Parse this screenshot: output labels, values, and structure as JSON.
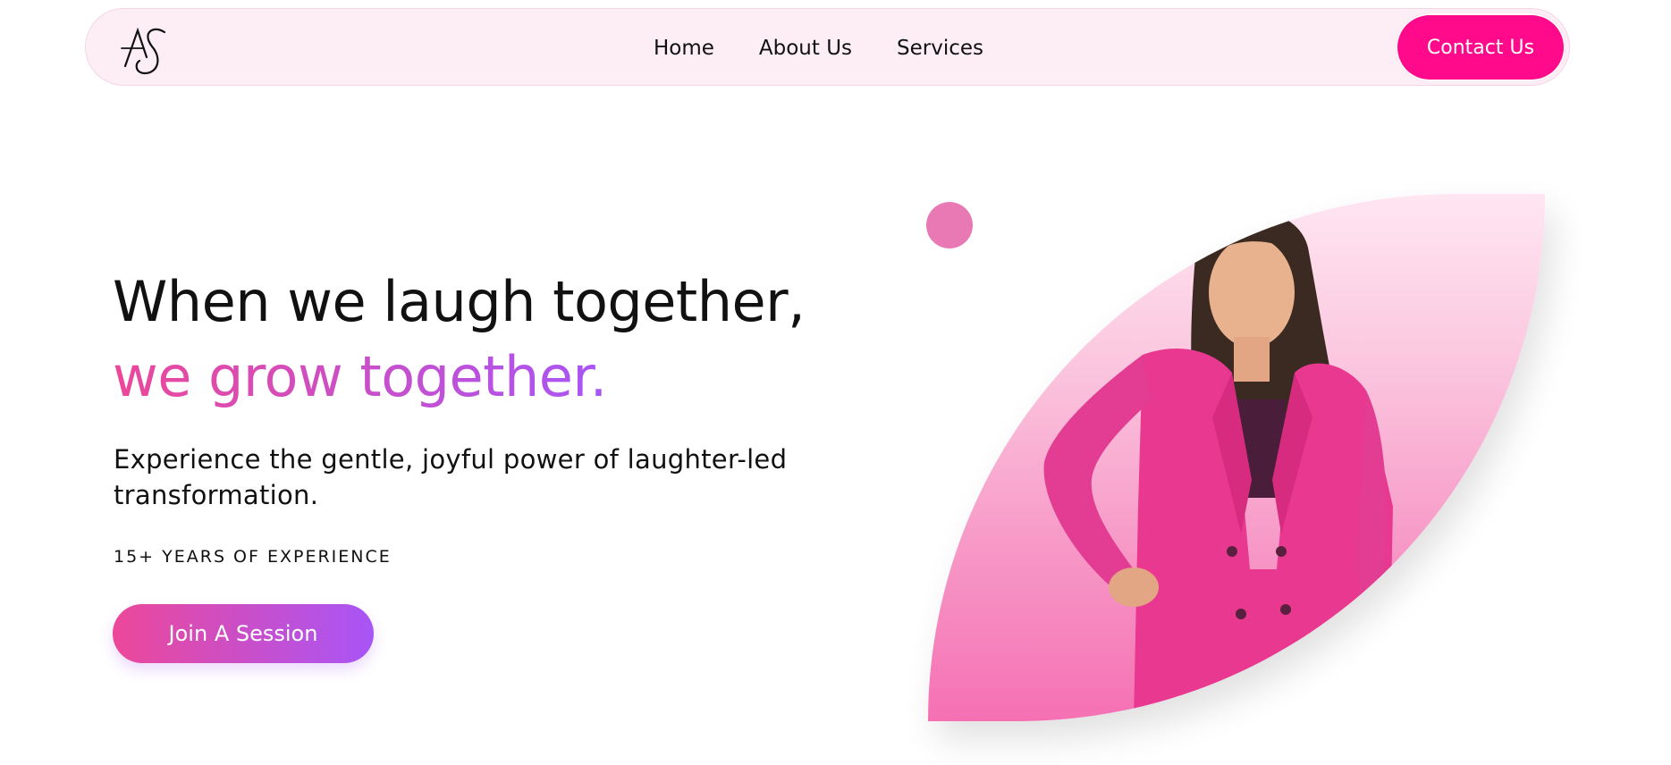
{
  "header": {
    "logo_text": "AS",
    "nav": [
      "Home",
      "About Us",
      "Services"
    ],
    "contact_label": "Contact Us"
  },
  "hero": {
    "title_line1": "When we laugh together,",
    "title_line2": "we grow together.",
    "subtitle": "Experience the gentle, joyful power of laughter-led transformation.",
    "experience": "15+ YEARS OF EXPERIENCE",
    "cta_label": "Join A Session"
  },
  "colors": {
    "brand_pink": "#ff0a8a",
    "gradient_start": "#ec4899",
    "gradient_end": "#a855f7",
    "nav_bg": "#fdeef6",
    "accent_dot": "#e879b4"
  },
  "icons": [
    "as-monogram-logo",
    "portrait-photo"
  ]
}
